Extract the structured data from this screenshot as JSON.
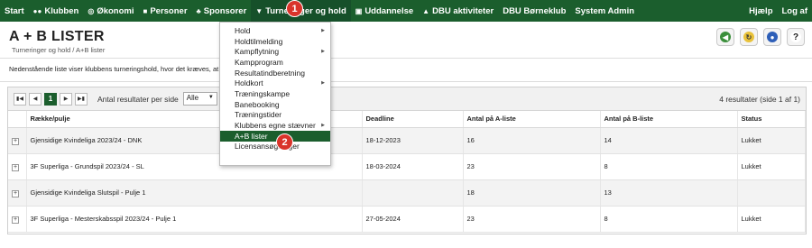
{
  "nav": {
    "items": [
      {
        "label": "Start",
        "icon": ""
      },
      {
        "label": "Klubben",
        "icon": "group-icon"
      },
      {
        "label": "Økonomi",
        "icon": "coin-icon"
      },
      {
        "label": "Personer",
        "icon": "person-icon"
      },
      {
        "label": "Sponsorer",
        "icon": "sponsor-icon"
      },
      {
        "label": "Turneringer og hold",
        "icon": "trophy-icon"
      },
      {
        "label": "Uddannelse",
        "icon": "board-icon"
      },
      {
        "label": "DBU aktiviteter",
        "icon": "cap-icon"
      },
      {
        "label": "DBU Børneklub",
        "icon": ""
      },
      {
        "label": "System Admin",
        "icon": ""
      }
    ],
    "right": [
      "Hjælp",
      "Log af"
    ]
  },
  "header": {
    "title": "A + B LISTER",
    "breadcrumb": "Turneringer og hold / A+B lister"
  },
  "info_text": "Nedenstående liste viser klubbens turneringshold, hvor det kræves, at man angi… rtet kan vælges fra.",
  "pager": {
    "current_page": "1",
    "per_page_label": "Antal resultater per side",
    "per_page_value": "Alle",
    "count_text": "4 resultater (side 1 af 1)"
  },
  "table": {
    "headers": [
      "Række/pulje",
      "Deadline",
      "Antal på A-liste",
      "Antal på B-liste",
      "Status"
    ],
    "rows": [
      {
        "name": "Gjensidige Kvindeliga 2023/24 - DNK",
        "deadline": "18-12-2023",
        "a": "16",
        "b": "14",
        "status": "Lukket"
      },
      {
        "name": "3F Superliga - Grundspil 2023/24 - SL",
        "deadline": "18-03-2024",
        "a": "23",
        "b": "8",
        "status": "Lukket"
      },
      {
        "name": "Gjensidige Kvindeliga Slutspil - Pulje 1",
        "deadline": "",
        "a": "18",
        "b": "13",
        "status": ""
      },
      {
        "name": "3F Superliga - Mesterskabsspil 2023/24 - Pulje 1",
        "deadline": "27-05-2024",
        "a": "23",
        "b": "8",
        "status": "Lukket"
      }
    ]
  },
  "dropdown": {
    "items": [
      {
        "label": "Hold",
        "sub": true
      },
      {
        "label": "Holdtilmelding",
        "sub": false
      },
      {
        "label": "Kampflytning",
        "sub": true
      },
      {
        "label": "Kampprogram",
        "sub": false
      },
      {
        "label": "Resultatindberetning",
        "sub": false
      },
      {
        "label": "Holdkort",
        "sub": true
      },
      {
        "label": "Træningskampe",
        "sub": false
      },
      {
        "label": "Banebooking",
        "sub": false
      },
      {
        "label": "Træningstider",
        "sub": false
      },
      {
        "label": "Klubbens egne stævner",
        "sub": true
      },
      {
        "label": "A+B lister",
        "sub": false
      },
      {
        "label": "Licensansøgninger",
        "sub": false
      }
    ],
    "selected_index": 10
  },
  "badges": [
    "1",
    "2"
  ],
  "colors": {
    "brand": "#1b5e2d",
    "badge": "#d9342b"
  }
}
